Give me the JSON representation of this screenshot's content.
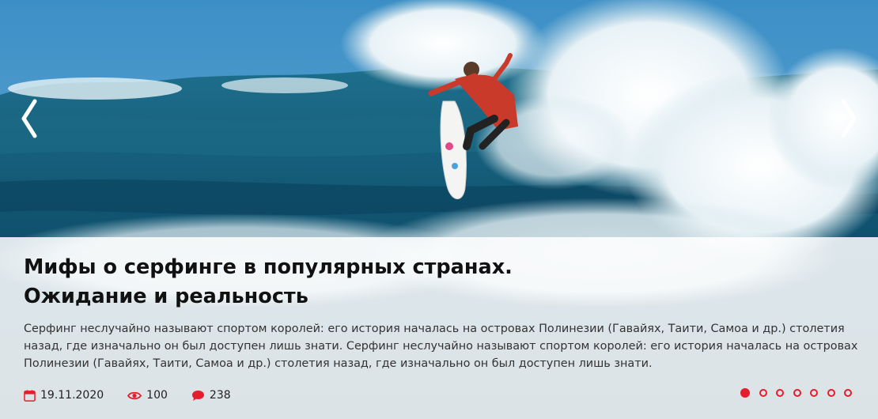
{
  "slide": {
    "title_line1": "Мифы о серфинге в популярных странах.",
    "title_line2": "Ожидание и реальность",
    "description": "Серфинг неслучайно называют спортом королей: его история началась на островах Полинезии (Гавайях, Таити, Самоа и др.) столетия назад, где изначально он был доступен лишь знати. Серфинг неслучайно называют спортом королей: его история началась на островах Полинезии (Гавайях, Таити, Самоа и др.) столетия назад, где изначально он был доступен лишь знати.",
    "date": "19.11.2020",
    "views": "100",
    "comments": "238"
  },
  "pagination": {
    "total": 7,
    "active": 1
  },
  "icons": {
    "prev": "chevron-left-icon",
    "next": "chevron-right-icon",
    "date": "calendar-icon",
    "views": "eye-icon",
    "comments": "comment-icon"
  },
  "colors": {
    "accent": "#e41e2c",
    "title": "#111111",
    "text": "#333333"
  }
}
